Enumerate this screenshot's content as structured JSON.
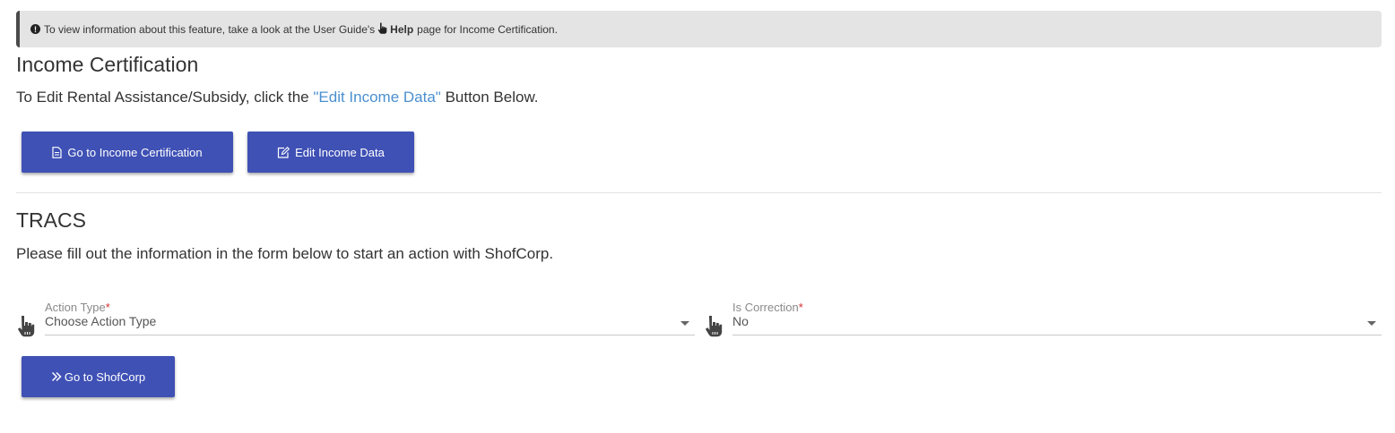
{
  "banner": {
    "text_before": "To view information about this feature, take a look at the User Guide's",
    "help_label": "Help",
    "text_after": "page for Income Certification."
  },
  "income_certification": {
    "title": "Income Certification",
    "desc_before": "To Edit Rental Assistance/Subsidy, click the",
    "desc_link": "\"Edit Income Data\"",
    "desc_after": "Button Below.",
    "go_button_label": "Go to Income Certification",
    "edit_button_label": "Edit Income Data"
  },
  "tracs": {
    "title": "TRACS",
    "desc": "Please fill out the information in the form below to start an action with ShofCorp.",
    "action_type": {
      "label": "Action Type",
      "required_mark": "*",
      "value": "Choose Action Type"
    },
    "is_correction": {
      "label": "Is Correction",
      "required_mark": "*",
      "value": "No"
    },
    "go_button_label": "Go to ShofCorp"
  },
  "colors": {
    "primary_button": "#3f51b5",
    "link": "#4a8fcf",
    "required": "#d32f2f",
    "banner_bg": "#e4e4e5"
  }
}
